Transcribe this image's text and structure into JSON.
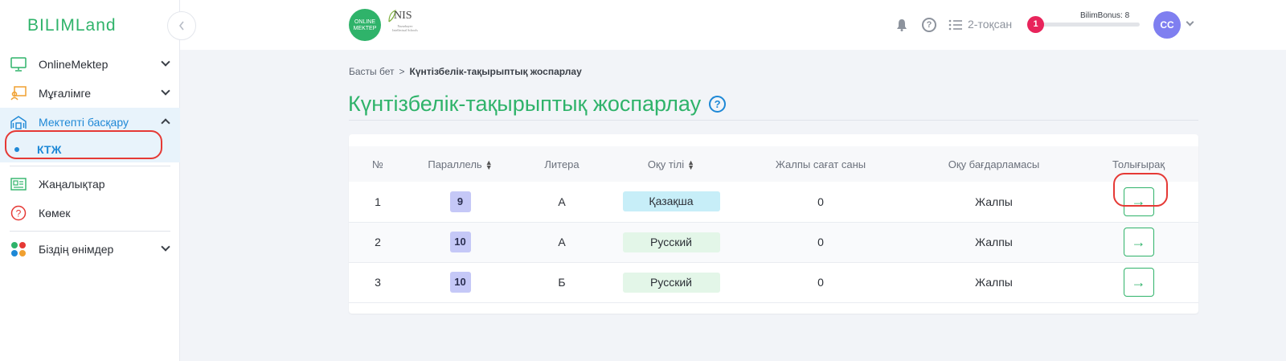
{
  "sidebar": {
    "logo": "BILIMLand",
    "collapse_icon": "chevron-left-icon",
    "items": [
      {
        "label": "OnlineMektep",
        "icon": "monitor-icon",
        "expandable": true
      },
      {
        "label": "Мұғалімге",
        "icon": "teacher-icon",
        "expandable": true
      },
      {
        "label": "Мектепті басқару",
        "icon": "school-icon",
        "expandable": true,
        "expanded": true
      },
      {
        "label": "КТЖ",
        "sub": true
      },
      {
        "label": "Жаңалықтар",
        "icon": "news-icon"
      },
      {
        "label": "Көмек",
        "icon": "help-circle-icon"
      },
      {
        "label": "Біздің өнімдер",
        "icon": "apps-icon",
        "expandable": true
      }
    ]
  },
  "header": {
    "om_logo_text": "ONLINE MEKTEP",
    "nis_logo_text": "NIS",
    "nis_logo_sub": "Nazarbayev Intellectual Schools",
    "quarter": "2-тоқсан",
    "bonus_count": "1",
    "bonus_label": "BilimBonus: 8",
    "avatar": "CC"
  },
  "breadcrumb": {
    "home": "Басты бет",
    "separator": ">",
    "current": "Күнтізбелік-тақырыптық жоспарлау"
  },
  "page": {
    "title": "Күнтізбелік-тақырыптық жоспарлау",
    "help_icon": "?"
  },
  "table": {
    "headers": [
      "№",
      "Параллель",
      "Литера",
      "Оқу тілі",
      "Жалпы сағат саны",
      "Оқу бағдарламасы",
      "Толығырақ"
    ],
    "rows": [
      {
        "num": "1",
        "parallel": "9",
        "litera": "А",
        "lang": "Қазақша",
        "hours": "0",
        "program": "Жалпы"
      },
      {
        "num": "2",
        "parallel": "10",
        "litera": "А",
        "lang": "Русский",
        "hours": "0",
        "program": "Жалпы"
      },
      {
        "num": "3",
        "parallel": "10",
        "litera": "Б",
        "lang": "Русский",
        "hours": "0",
        "program": "Жалпы"
      }
    ],
    "detail_icon": "→"
  },
  "colors": {
    "brand_green": "#2fb36a",
    "active_blue": "#1e88d6",
    "annotation_red": "#e53935",
    "badge_pink": "#e8245b"
  }
}
